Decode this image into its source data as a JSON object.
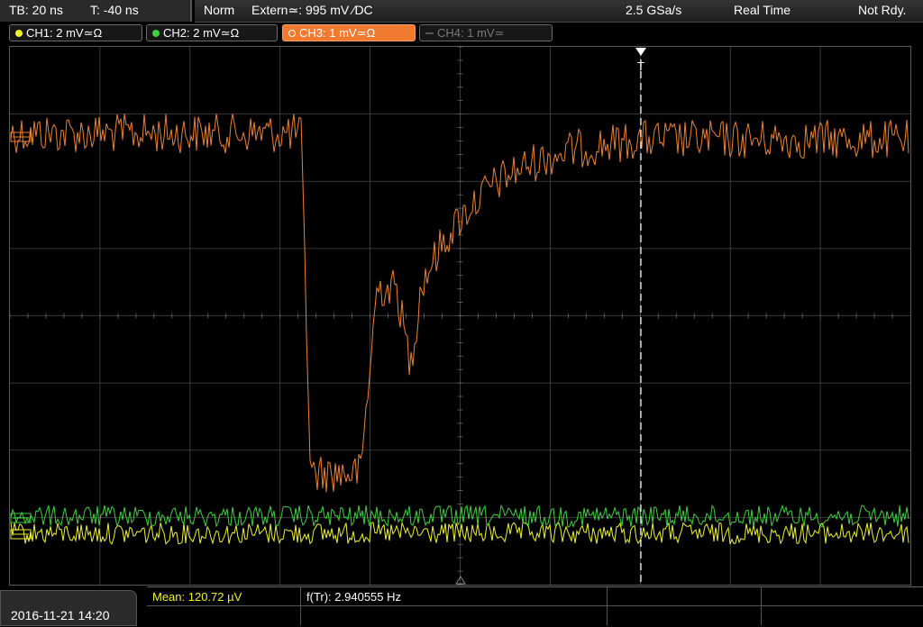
{
  "header": {
    "timebase": "TB: 20 ns",
    "trigger_time": "T: -40 ns",
    "acq_mode": "Norm",
    "trigger_source": "Extern≃: 995 mV ∕DC",
    "sample_rate": "2.5 GSa/s",
    "time_mode": "Real Time",
    "status": "Not Rdy."
  },
  "channels": [
    {
      "label": "CH1: 2 mV≃Ω",
      "color": "#f2f22a",
      "active": true
    },
    {
      "label": "CH2: 2 mV≃Ω",
      "color": "#3ad13a",
      "active": true
    },
    {
      "label": "CH3: 1 mV≃Ω",
      "color": "#f08030",
      "active": true,
      "selected": true
    },
    {
      "label": "CH4: 1 mV≃",
      "color": "#777777",
      "active": false
    }
  ],
  "trigger_marker": "T",
  "footer": {
    "datetime": "2016-11-21 14:20",
    "mean": "Mean: 120.72 µV",
    "freq": "f(Tr): 2.940555 Hz"
  },
  "colors": {
    "ch1": "#f2f22a",
    "ch2": "#3ad13a",
    "ch3": "#f08030",
    "grid": "#4a4a4a"
  }
}
